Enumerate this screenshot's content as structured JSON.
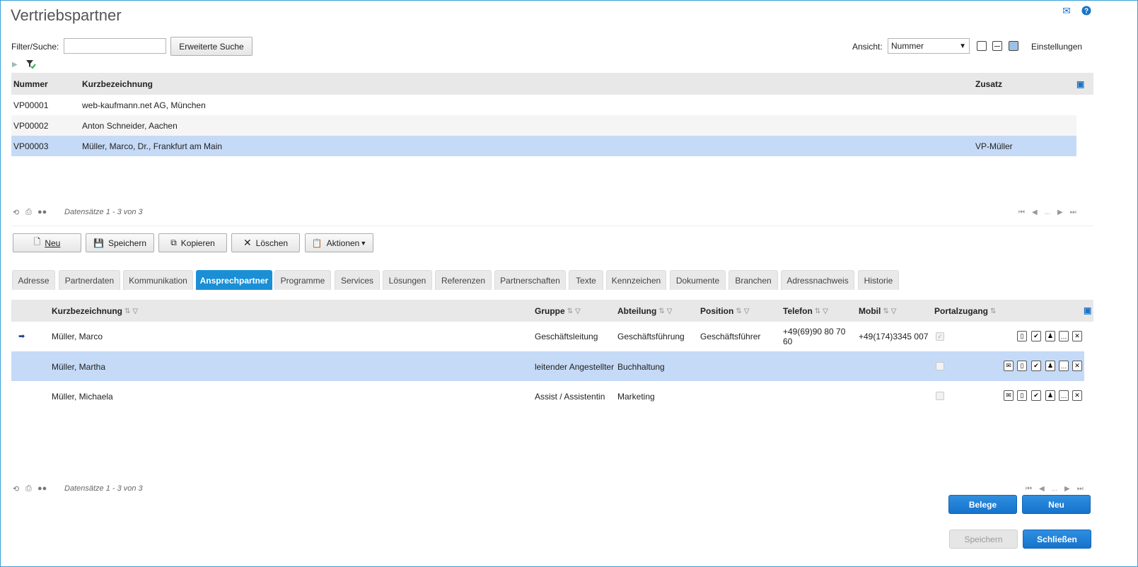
{
  "page": {
    "title": "Vertriebspartner"
  },
  "filter": {
    "label": "Filter/Suche:",
    "value": "",
    "extended_search_label": "Erweiterte Suche",
    "view_label": "Ansicht:",
    "view_value": "Nummer",
    "settings_label": "Einstellungen"
  },
  "partners": {
    "columns": {
      "number": "Nummer",
      "short": "Kurzbezeichnung",
      "extra": "Zusatz"
    },
    "rows": [
      {
        "number": "VP00001",
        "short": "web-kaufmann.net AG, München",
        "extra": ""
      },
      {
        "number": "VP00002",
        "short": "Anton Schneider, Aachen",
        "extra": ""
      },
      {
        "number": "VP00003",
        "short": "Müller, Marco, Dr., Frankfurt am Main",
        "extra": "VP-Müller"
      }
    ],
    "footer": "Datensätze 1 - 3 von 3",
    "pager_dots": "..."
  },
  "toolbar": {
    "new": "Neu",
    "save": "Speichern",
    "copy": "Kopieren",
    "delete": "Löschen",
    "actions": "Aktionen"
  },
  "tabs": [
    "Adresse",
    "Partnerdaten",
    "Kommunikation",
    "Ansprechpartner",
    "Programme",
    "Services",
    "Lösungen",
    "Referenzen",
    "Partnerschaften",
    "Texte",
    "Kennzeichen",
    "Dokumente",
    "Branchen",
    "Adressnachweis",
    "Historie"
  ],
  "contacts": {
    "columns": {
      "short": "Kurzbezeichnung",
      "group": "Gruppe",
      "dept": "Abteilung",
      "position": "Position",
      "phone": "Telefon",
      "mobile": "Mobil",
      "portal": "Portalzugang"
    },
    "rows": [
      {
        "short": "Müller, Marco",
        "group": "Geschäftsleitung",
        "dept": "Geschäftsführung",
        "position": "Geschäftsführer",
        "phone_line1": "+49(69)90 80 70",
        "phone_line2": "60",
        "mobile": "+49(174)3345 007",
        "portal": true
      },
      {
        "short": "Müller, Martha",
        "group": "leitender Angestellter",
        "dept": "Buchhaltung",
        "position": "",
        "phone_line1": "",
        "phone_line2": "",
        "mobile": "",
        "portal": false
      },
      {
        "short": "Müller, Michaela",
        "group": "Assist / Assistentin",
        "dept": "Marketing",
        "position": "",
        "phone_line1": "",
        "phone_line2": "",
        "mobile": "",
        "portal": false
      }
    ],
    "footer": "Datensätze 1 - 3 von 3",
    "pager_dots": "..."
  },
  "bottom": {
    "belege": "Belege",
    "new": "Neu",
    "save": "Speichern",
    "close": "Schließen"
  },
  "colors": {
    "accent": "#1a8fd6",
    "selected_row": "#c5daf6",
    "header_bg": "#e8e8e8"
  }
}
